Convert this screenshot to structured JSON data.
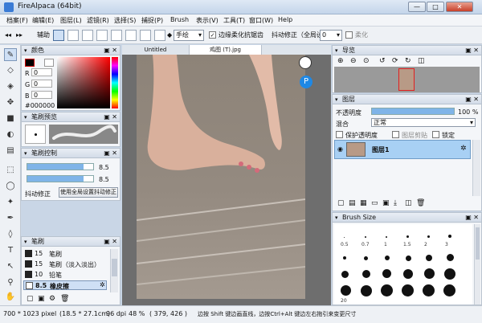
{
  "window": {
    "title": "FireAlpaca (64bit)",
    "minimize": "—",
    "maximize": "□",
    "close": "✕"
  },
  "menu": [
    "档案(F)",
    "编辑(E)",
    "图层(L)",
    "滤镜(R)",
    "选择(S)",
    "捕捉(P)",
    "Brush",
    "表示(V)",
    "工具(T)",
    "窗口(W)",
    "Help"
  ],
  "toolbar": {
    "assist_label": "辅助",
    "handdraw_value": "手绘",
    "antialias_label": "边缘柔化抗锯齿",
    "antialias_checked": true,
    "stabilizer_label": "抖动修正（全局设置）",
    "stabilizer_value": "0",
    "soften_label": "柔化"
  },
  "color_panel": {
    "title": "颜色",
    "r_label": "R",
    "r_value": "0",
    "g_label": "G",
    "g_value": "0",
    "b_label": "B",
    "b_value": "0",
    "hex": "#000000"
  },
  "brush_preview": {
    "title": "笔刷预览"
  },
  "brush_control": {
    "title": "笔刷控制",
    "size_value": "8.5",
    "size_fraction": 0.85,
    "opacity_value": "8.5",
    "opacity_fraction": 0.85,
    "stabilizer_label": "抖动修正",
    "use_global_button": "使用全局设置抖动修正"
  },
  "brush_panel": {
    "title": "笔刷",
    "items": [
      {
        "size": "15",
        "name": "笔刷",
        "selected": false
      },
      {
        "size": "15",
        "name": "笔刷（淡入淡出）",
        "selected": false
      },
      {
        "size": "10",
        "name": "铅笔",
        "selected": false
      },
      {
        "size": "8.5",
        "name": "橡皮擦",
        "selected": true
      }
    ]
  },
  "canvas": {
    "tabs": [
      {
        "label": "Untitled",
        "active": false
      },
      {
        "label": "鸡图 (T).jpg",
        "active": true
      }
    ]
  },
  "navigator": {
    "title": "导览"
  },
  "layers": {
    "title": "图层",
    "opacity_label": "不透明度",
    "opacity_value": "100 %",
    "opacity_fraction": 1.0,
    "blend_label": "混合",
    "blend_value": "正常",
    "protect_label": "保护透明度",
    "clip_label": "图层剪贴",
    "lock_label": "锁定",
    "layer_name": "图层1"
  },
  "brush_size": {
    "title": "Brush Size",
    "rows": [
      [
        "0.5",
        "0.7",
        "1",
        "1.5",
        "2",
        "3"
      ],
      [
        "",
        "",
        "",
        "",
        "",
        ""
      ],
      [
        "",
        "",
        "",
        "",
        "",
        ""
      ],
      [
        "",
        "",
        "",
        "",
        "",
        ""
      ],
      [
        "20",
        "",
        "",
        "",
        "",
        ""
      ]
    ]
  },
  "status": {
    "size": "700 * 1023 pixel",
    "cm": "(18.5 * 27.1cm)",
    "dpi": "96 dpi",
    "zoom": "48 %",
    "coords": "( 379, 426 )",
    "hint": "边按 Shift 键边画直线，边按Ctrl+Alt 键边左右拖引来变更尺寸"
  },
  "colors": {
    "accent": "#3a7bd5",
    "selection": "#cfe0f5",
    "progress": "#7fb4e8"
  }
}
